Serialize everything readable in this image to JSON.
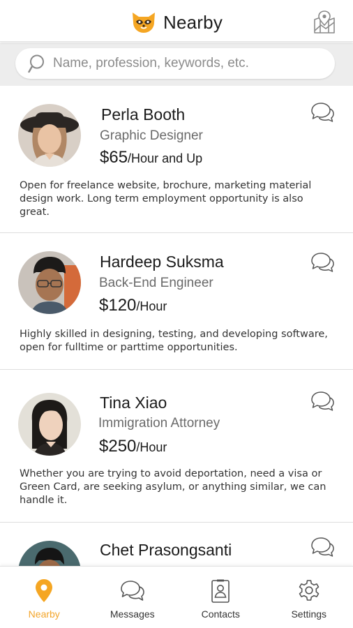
{
  "app": {
    "title": "Nearby",
    "accent_color": "#f5a623",
    "logo_icon": "raccoon-logo-icon",
    "map_icon": "map-pin-icon"
  },
  "search": {
    "placeholder": "Name, profession, keywords, etc.",
    "value": "",
    "icon": "search-icon"
  },
  "profiles": [
    {
      "name": "Perla Booth",
      "profession": "Graphic Designer",
      "rate_amount": "$65",
      "rate_suffix": "/Hour and Up",
      "description": "Open for freelance website, brochure, marketing material design work. Long term employment opportunity is also great.",
      "chat_icon": "chat-bubbles-icon"
    },
    {
      "name": "Hardeep Suksma",
      "profession": "Back-End Engineer",
      "rate_amount": "$120",
      "rate_suffix": "/Hour",
      "description": "Highly skilled in designing, testing, and developing software, open for fulltime or parttime opportunities.",
      "chat_icon": "chat-bubbles-icon"
    },
    {
      "name": "Tina Xiao",
      "profession": "Immigration Attorney",
      "rate_amount": "$250",
      "rate_suffix": "/Hour",
      "description": "Whether you are trying to avoid deportation, need a visa or Green Card, are seeking asylum, or anything similar, we can handle it.",
      "chat_icon": "chat-bubbles-icon"
    },
    {
      "name": "Chet Prasongsanti",
      "chat_icon": "chat-bubbles-icon"
    }
  ],
  "tabs": [
    {
      "label": "Nearby",
      "icon": "location-pin-icon",
      "active": true
    },
    {
      "label": "Messages",
      "icon": "chat-bubbles-icon",
      "active": false
    },
    {
      "label": "Contacts",
      "icon": "contact-card-icon",
      "active": false
    },
    {
      "label": "Settings",
      "icon": "gear-icon",
      "active": false
    }
  ]
}
